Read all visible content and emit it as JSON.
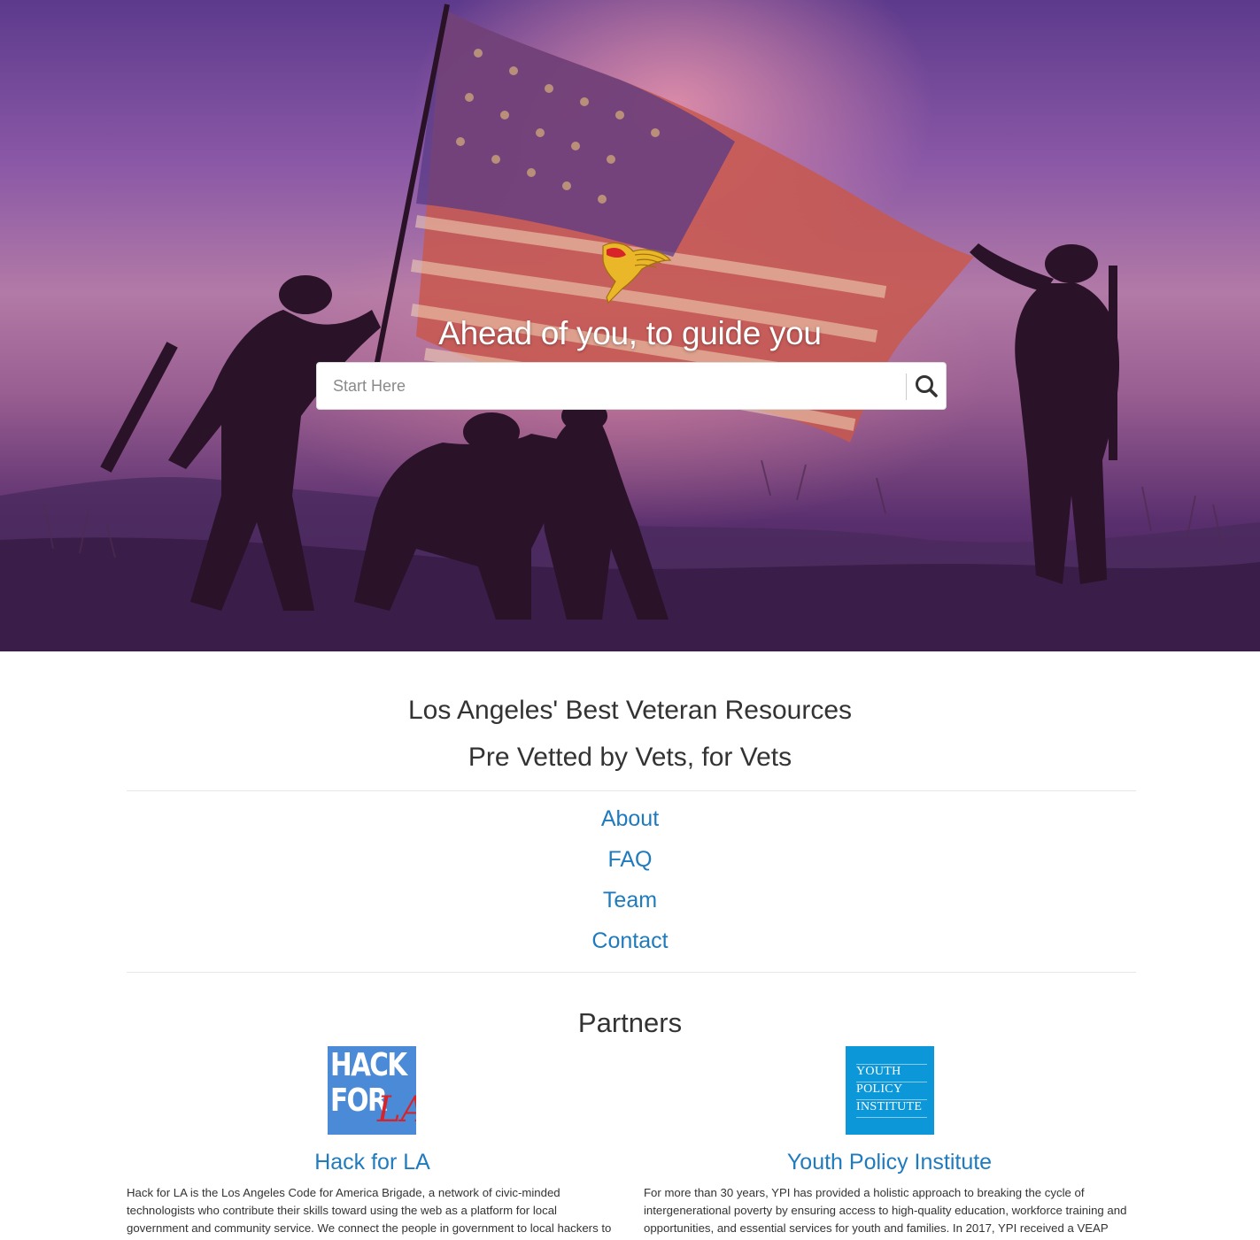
{
  "hero": {
    "tagline": "Ahead of you, to guide you",
    "search": {
      "placeholder": "Start Here",
      "value": "",
      "button_icon": "search-icon"
    },
    "logo_icon": "winged-p-insignia-icon"
  },
  "headline": {
    "line1": "Los Angeles' Best Veteran Resources",
    "line2": "Pre Vetted by Vets, for Vets"
  },
  "nav": {
    "items": [
      {
        "label": "About"
      },
      {
        "label": "FAQ"
      },
      {
        "label": "Team"
      },
      {
        "label": "Contact"
      }
    ]
  },
  "partners": {
    "title": "Partners",
    "items": [
      {
        "name": "Hack for LA",
        "logo_text": [
          "HACK",
          "FOR",
          "LA"
        ],
        "description": "Hack for LA is the Los Angeles Code for America Brigade, a network of civic-minded technologists who contribute their skills toward using the web as a platform for local government and community service. We connect the people in government to local hackers to"
      },
      {
        "name": "Youth Policy Institute",
        "logo_text": [
          "YOUTH",
          "POLICY",
          "INSTITUTE"
        ],
        "description": "For more than 30 years, YPI has provided a holistic approach to breaking the cycle of intergenerational poverty by ensuring access to high-quality education, workforce training and opportunities, and essential services for youth and families. In 2017, YPI received a VEAP"
      }
    ]
  },
  "colors": {
    "link": "#1f7bbd",
    "text": "#333333",
    "hackla_bg": "#4a8ad6",
    "hackla_accent": "#d8232a",
    "ypi_bg": "#0c97d8"
  }
}
